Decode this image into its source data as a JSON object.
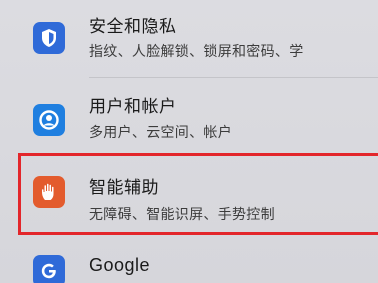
{
  "settings": {
    "items": [
      {
        "title": "安全和隐私",
        "subtitle": "指纹、人脸解锁、锁屏和密码、学",
        "icon": "shield-icon",
        "icon_color": "#2f6ad8"
      },
      {
        "title": "用户和帐户",
        "subtitle": "多用户、云空间、帐户",
        "icon": "user-account-icon",
        "icon_color": "#1f7fe0"
      },
      {
        "title": "智能辅助",
        "subtitle": "无障碍、智能识屏、手势控制",
        "icon": "hand-icon",
        "icon_color": "#e35b2d"
      },
      {
        "title": "Google",
        "subtitle": "",
        "icon": "google-icon",
        "icon_color": "#2f6ad8"
      }
    ]
  },
  "highlight_color": "#e3262b"
}
